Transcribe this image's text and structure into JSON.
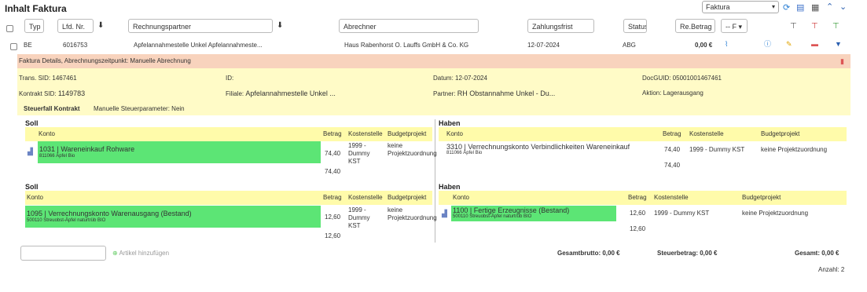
{
  "header": {
    "title": "Inhalt Faktura",
    "select_value": "Faktura"
  },
  "filters": {
    "typ": "Typ",
    "lfd_nr": "Lfd. Nr.",
    "rechnungspartner": "Rechnungspartner",
    "abrechner": "Abrechner",
    "zahlungsfrist": "Zahlungsfrist",
    "status": "Status",
    "re_betrag": "Re.Betrag",
    "select": "-- F"
  },
  "row": {
    "typ": "BE",
    "lfd_nr": "6016753",
    "rechnungspartner": "Apfelannahmestelle Unkel Apfelannahmeste...",
    "abrechner": "Haus Rabenhorst O. Lauffs GmbH & Co. KG",
    "datum": "12-07-2024",
    "status": "ABG",
    "betrag": "0,00 €"
  },
  "detail": {
    "bar": "Faktura Details, Abrechnungszeitpunkt: Manuelle Abrechnung",
    "trans_sid": "Trans. SID: 1467461",
    "id": "ID:",
    "datum": "Datum: 12-07-2024",
    "docguid": "DocGUID: 05001001467461",
    "kontrakt_label": "Kontrakt SID:",
    "kontrakt_value": "1149783",
    "filiale_label": "Filiale:",
    "filiale_value": "Apfelannahmestelle Unkel ...",
    "partner_label": "Partner:",
    "partner_value": "RH Obstannahme Unkel - Du...",
    "aktion": "Aktion: Lagerausgang",
    "steuerfall": "Steuerfall Kontrakt",
    "steuerparam": "Manuelle Steuerparameter: Nein"
  },
  "cols": {
    "konto": "Konto",
    "betrag": "Betrag",
    "kostenstelle": "Kostenstelle",
    "budgetprojekt": "Budgetprojekt"
  },
  "block1": {
    "soll_title": "Soll",
    "haben_title": "Haben",
    "soll_konto": "1031 | Wareneinkauf Rohware",
    "soll_sub": "811066 Äpfel Bio",
    "soll_betrag": "74,40",
    "soll_kst": "1999 - Dummy KST",
    "soll_budget": "keine Projektzuordnung",
    "soll_total": "74,40",
    "haben_konto": "3310 | Verrechnungskonto Verbindlichkeiten Wareneinkauf",
    "haben_sub": "811066 Äpfel Bio",
    "haben_betrag": "74,40",
    "haben_kst": "1999 - Dummy KST",
    "haben_budget": "keine Projektzuordnung",
    "haben_total": "74,40"
  },
  "block2": {
    "soll_title": "Soll",
    "haben_title": "Haben",
    "soll_konto": "1095 | Verrechnungskonto Warenausgang (Bestand)",
    "soll_sub": "500110 Streuobst-Äpfel naturtrüb BIO",
    "soll_betrag": "12,60",
    "soll_kst": "1999 - Dummy KST",
    "soll_budget": "keine Projektzuordnung",
    "soll_total": "12,60",
    "haben_konto": "1100 | Fertige Erzeugnisse (Bestand)",
    "haben_sub": "500110 Streuobst-Äpfel naturtrüb BIO",
    "haben_betrag": "12,60",
    "haben_kst": "1999 - Dummy KST",
    "haben_budget": "keine Projektzuordnung",
    "haben_total": "12,60"
  },
  "footer": {
    "add_article": "Artikel hinzufügen",
    "gesamtbrutto": "Gesamtbrutto: 0,00 €",
    "steuerbetrag": "Steuerbetrag: 0,00 €",
    "gesamt": "Gesamt: 0,00 €",
    "anzahl": "Anzahl: 2"
  }
}
